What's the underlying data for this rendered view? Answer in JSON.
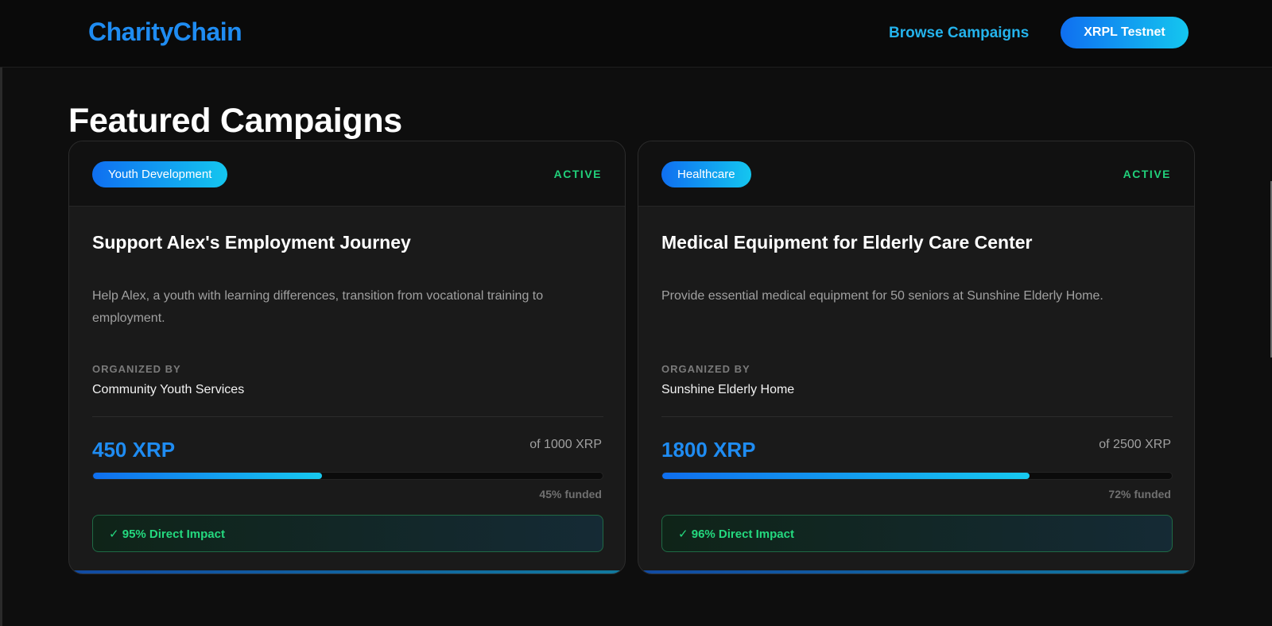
{
  "header": {
    "logo": "CharityChain",
    "nav_link": "Browse Campaigns",
    "network_button": "XRPL Testnet"
  },
  "section_title": "Featured Campaigns",
  "colors": {
    "accent_blue": "#1f8cf2",
    "accent_cyan": "#14c6ef",
    "status_green": "#21d07a"
  },
  "campaigns": [
    {
      "category": "Youth Development",
      "status": "ACTIVE",
      "title": "Support Alex's Employment Journey",
      "description": "Help Alex, a youth with learning differences, transition from vocational training to employment.",
      "organized_label": "ORGANIZED BY",
      "organizer": "Community Youth Services",
      "raised": "450 XRP",
      "goal": "of 1000 XRP",
      "progress_percent": 45,
      "funded_text": "45% funded",
      "impact": "✓ 95% Direct Impact"
    },
    {
      "category": "Healthcare",
      "status": "ACTIVE",
      "title": "Medical Equipment for Elderly Care Center",
      "description": "Provide essential medical equipment for 50 seniors at Sunshine Elderly Home.",
      "organized_label": "ORGANIZED BY",
      "organizer": "Sunshine Elderly Home",
      "raised": "1800 XRP",
      "goal": "of 2500 XRP",
      "progress_percent": 72,
      "funded_text": "72% funded",
      "impact": "✓ 96% Direct Impact"
    }
  ]
}
